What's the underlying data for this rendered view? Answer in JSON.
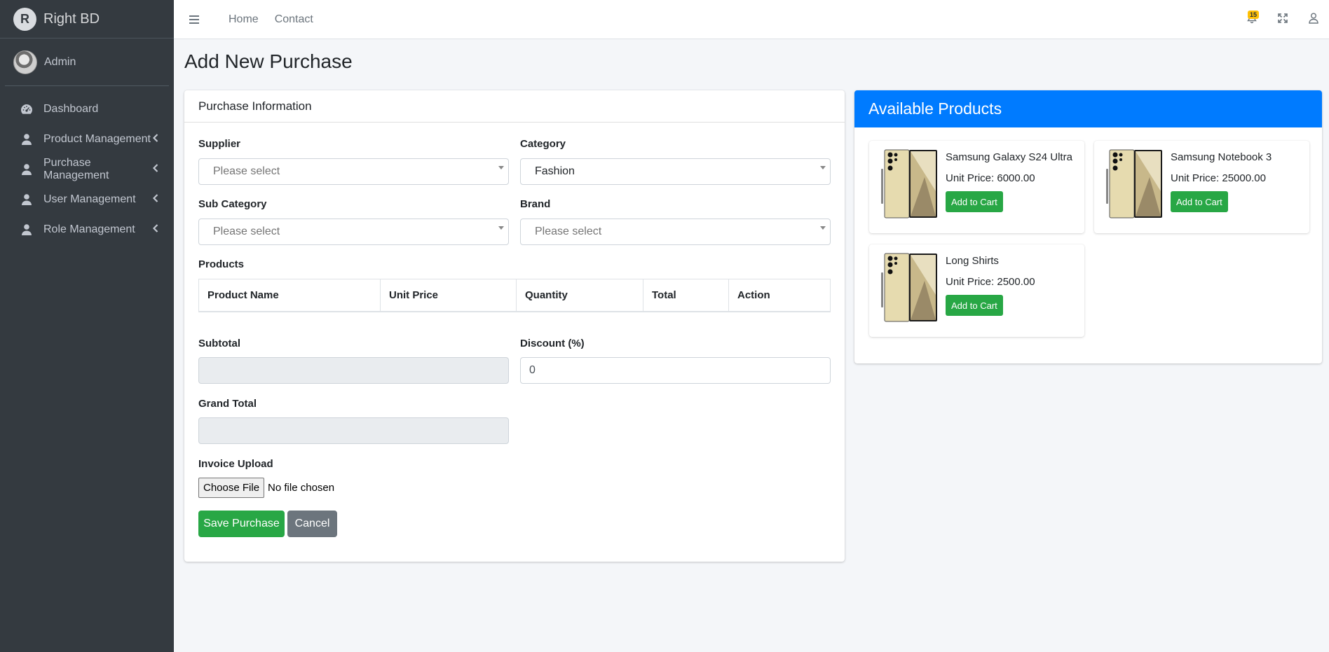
{
  "brand": {
    "logo_letter": "R",
    "name": "Right BD"
  },
  "user": {
    "name": "Admin"
  },
  "sidebar": {
    "items": [
      {
        "label": "Dashboard",
        "icon": "tachometer-icon"
      },
      {
        "label": "Product Management",
        "icon": "user-icon"
      },
      {
        "label": "Purchase Management",
        "icon": "user-icon"
      },
      {
        "label": "User Management",
        "icon": "user-icon"
      },
      {
        "label": "Role Management",
        "icon": "user-icon"
      }
    ]
  },
  "topbar": {
    "links": [
      "Home",
      "Contact"
    ],
    "notification_count": "15"
  },
  "page": {
    "title": "Add New Purchase"
  },
  "purchase_form": {
    "header": "Purchase Information",
    "supplier": {
      "label": "Supplier",
      "value": "Please select"
    },
    "category": {
      "label": "Category",
      "value": "Fashion"
    },
    "sub_category": {
      "label": "Sub Category",
      "value": "Please select"
    },
    "brand": {
      "label": "Brand",
      "value": "Please select"
    },
    "products_label": "Products",
    "table_headers": [
      "Product Name",
      "Unit Price",
      "Quantity",
      "Total",
      "Action"
    ],
    "subtotal": {
      "label": "Subtotal",
      "value": ""
    },
    "discount": {
      "label": "Discount (%)",
      "value": "0"
    },
    "grand_total": {
      "label": "Grand Total",
      "value": ""
    },
    "invoice": {
      "label": "Invoice Upload",
      "button": "Choose File",
      "status": "No file chosen"
    },
    "save_label": "Save Purchase",
    "cancel_label": "Cancel"
  },
  "available_products": {
    "header": "Available Products",
    "price_prefix": "Unit Price: ",
    "add_label": "Add to Cart",
    "items": [
      {
        "name": "Samsung Galaxy S24 Ultra",
        "price": "6000.00"
      },
      {
        "name": "Samsung Notebook 3",
        "price": "25000.00"
      },
      {
        "name": "Long Shirts",
        "price": "2500.00"
      }
    ]
  },
  "colors": {
    "sidebar_bg": "#343a40",
    "primary": "#007bff",
    "success": "#28a745",
    "secondary": "#6c757d",
    "badge": "#ffc107"
  }
}
